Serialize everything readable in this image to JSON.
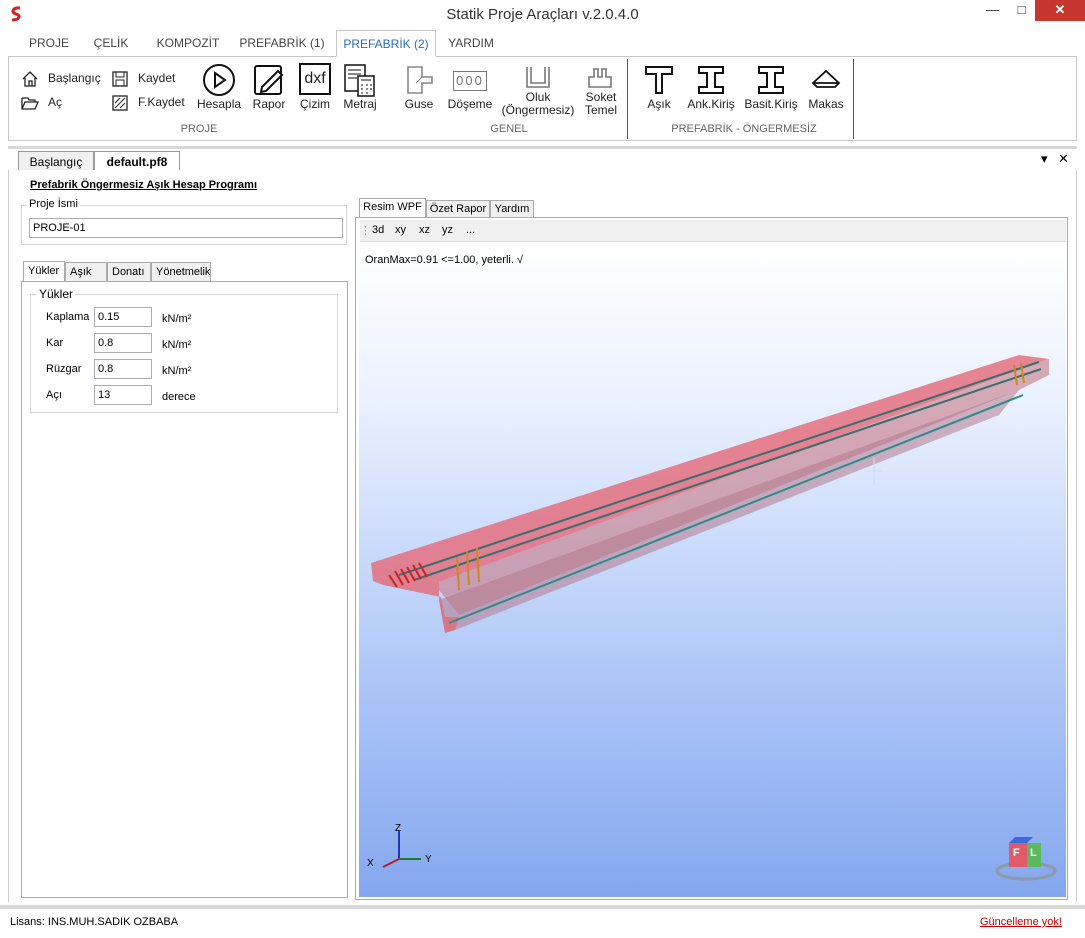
{
  "window": {
    "title": "Statik Proje Araçları v.2.0.4.0",
    "minimize": "—",
    "maximize": "□",
    "close": "✕"
  },
  "ribbon": {
    "tabs": [
      "PROJE",
      "ÇELİK",
      "KOMPOZİT",
      "PREFABRİK (1)",
      "PREFABRİK (2)",
      "YARDIM"
    ],
    "active_tab": "PREFABRİK (2)",
    "small_buttons": {
      "baslangic": "Başlangıç",
      "ac": "Aç",
      "kaydet": "Kaydet",
      "fkaydet": "F.Kaydet"
    },
    "buttons": {
      "hesapla": "Hesapla",
      "rapor": "Rapor",
      "cizim": "Çizim",
      "metraj": "Metraj",
      "guse": "Guse",
      "doseme": "Döşeme",
      "oluk_line1": "Oluk",
      "oluk_line2": "(Öngermesiz)",
      "soket_line1": "Soket",
      "soket_line2": "Temel",
      "asik": "Aşık",
      "ank_kiris": "Ank.Kiriş",
      "basit_kiris": "Basit.Kiriş",
      "makas": "Makas"
    },
    "dxf_icon_text": "dxf",
    "doseme_icon_text": "000",
    "groups": {
      "proje": "PROJE",
      "genel": "GENEL",
      "prefabrik": "PREFABRİK - ÖNGERMESİZ"
    }
  },
  "doc_tabs": {
    "tab1": "Başlangıç",
    "tab2": "default.pf8",
    "dropdown": "▾",
    "close": "✕"
  },
  "main": {
    "program_title": "Prefabrik Öngermesiz Aşık Hesap Programı",
    "proje_isim_label": "Proje İsmi",
    "proje_isim_value": "PROJE-01",
    "left_tabs": [
      "Yükler",
      "Aşık",
      "Donatı",
      "Yönetmelik"
    ],
    "loads_group_label": "Yükler",
    "loads": [
      {
        "label": "Kaplama",
        "value": "0.15",
        "unit": "kN/m²"
      },
      {
        "label": "Kar",
        "value": "0.8",
        "unit": "kN/m²"
      },
      {
        "label": "Rüzgar",
        "value": "0.8",
        "unit": "kN/m²"
      },
      {
        "label": "Açı",
        "value": "13",
        "unit": "derece"
      }
    ]
  },
  "viewer": {
    "tabs": [
      "Resim WPF",
      "Özet Rapor",
      "Yardım"
    ],
    "toolbar": [
      "3d",
      "xy",
      "xz",
      "yz",
      "..."
    ],
    "status_text": "OranMax=0.91 <=1.00, yeterli. √",
    "axis": {
      "z": "Z",
      "x": "X",
      "y": "Y"
    },
    "cube": {
      "front": "F",
      "left": "L"
    }
  },
  "status": {
    "license": "Lisans: INS.MUH.SADIK OZBABA",
    "update": "Güncelleme yok!"
  },
  "colors": {
    "accent": "#2a6ebb",
    "beam_fill": "#e87a8a",
    "close_red": "#c7372f",
    "update_red": "#c00000"
  }
}
